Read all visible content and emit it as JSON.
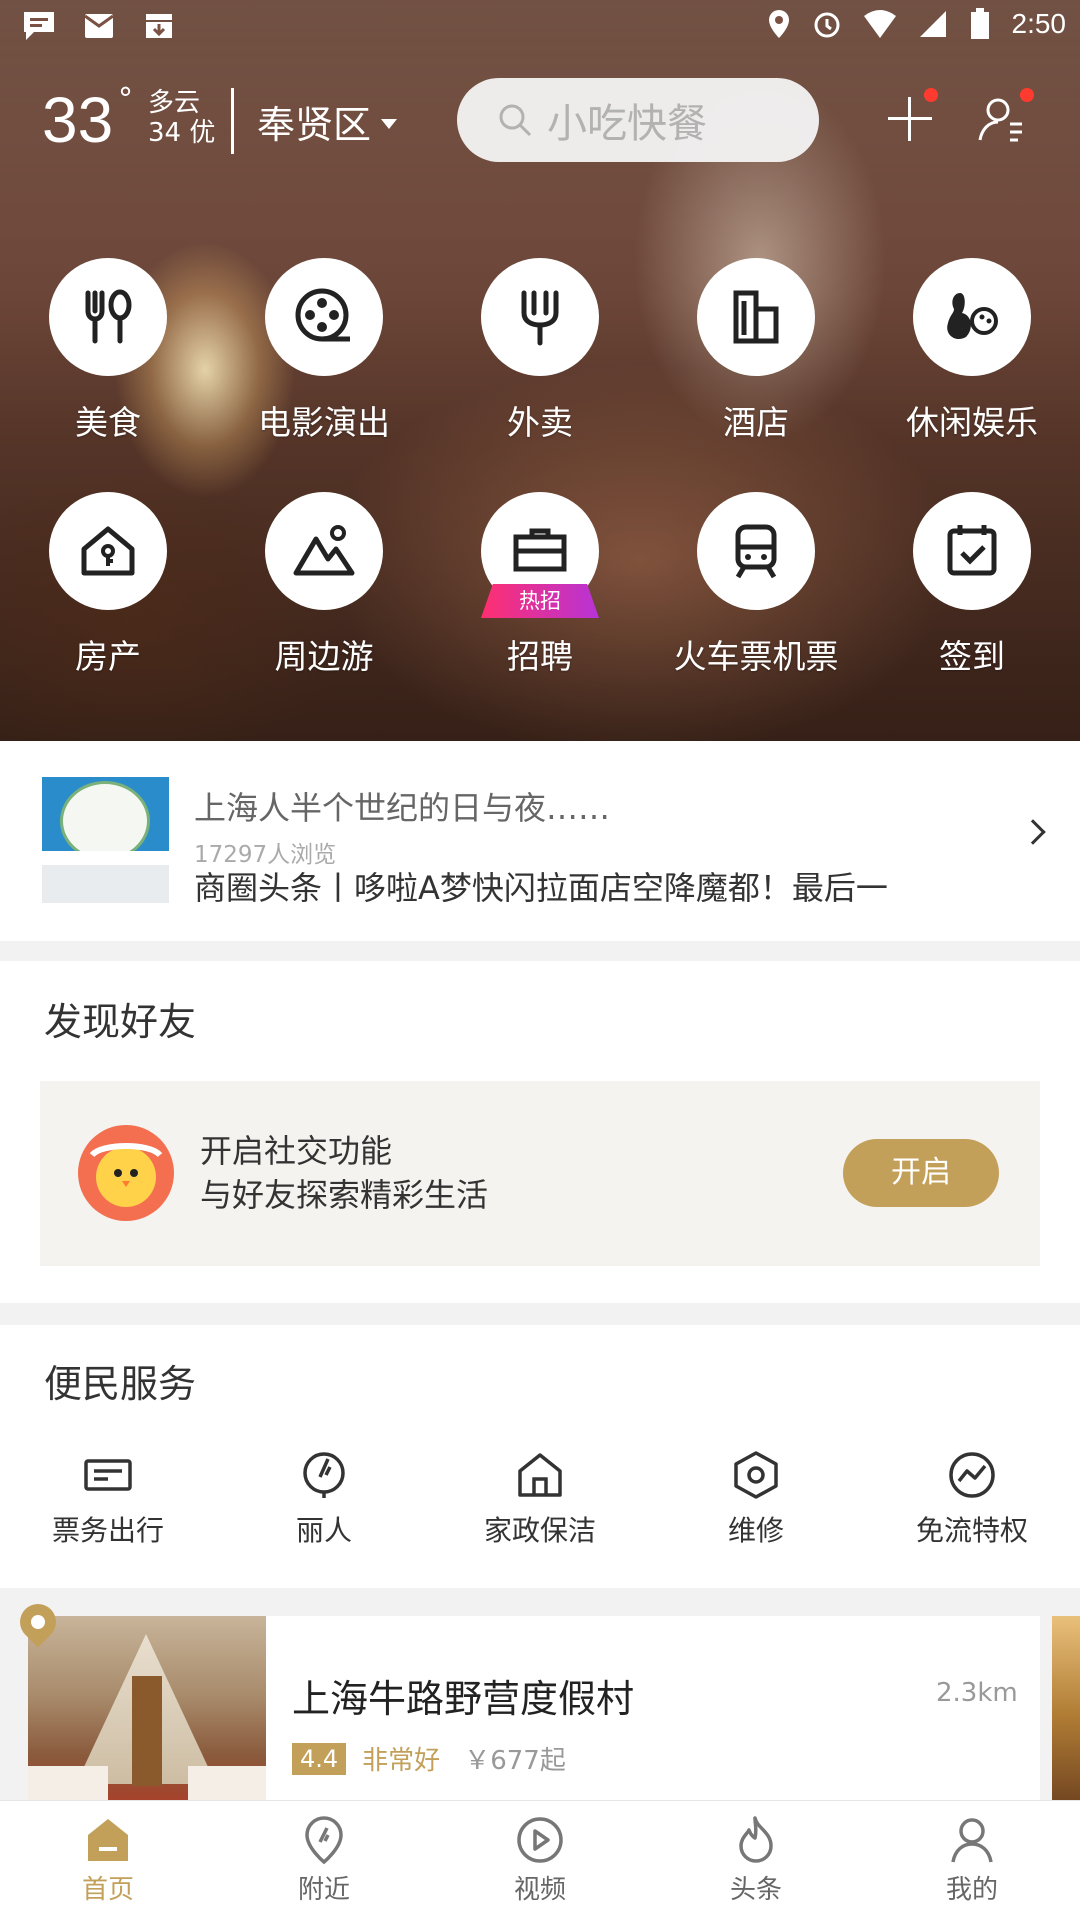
{
  "status_bar": {
    "time": "2:50"
  },
  "header": {
    "temperature": "33",
    "degree": "°",
    "weather": "多云",
    "aqi": "34 优",
    "district": "奉贤区",
    "search_placeholder": "小吃快餐"
  },
  "categories_row1": [
    {
      "label": "美食",
      "icon": "food-icon"
    },
    {
      "label": "电影演出",
      "icon": "film-reel-icon"
    },
    {
      "label": "外卖",
      "icon": "fork-icon"
    },
    {
      "label": "酒店",
      "icon": "hotel-icon"
    },
    {
      "label": "休闲娱乐",
      "icon": "leisure-icon"
    }
  ],
  "categories_row2": [
    {
      "label": "房产",
      "icon": "house-key-icon"
    },
    {
      "label": "周边游",
      "icon": "mountain-icon"
    },
    {
      "label": "招聘",
      "icon": "briefcase-icon",
      "badge": "热招"
    },
    {
      "label": "火车票机票",
      "icon": "train-icon"
    },
    {
      "label": "签到",
      "icon": "calendar-check-icon"
    }
  ],
  "news": {
    "headline": "上海人半个世纪的日与夜……",
    "views": "17297人浏览",
    "next_headline": "商圈头条丨哆啦A梦快闪拉面店空降魔都！最后一"
  },
  "friends": {
    "title": "发现好友",
    "line1": "开启社交功能",
    "line2": "与好友探索精彩生活",
    "button": "开启"
  },
  "services": {
    "title": "便民服务",
    "items": [
      {
        "label": "票务出行",
        "icon": "ticket-icon"
      },
      {
        "label": "丽人",
        "icon": "beauty-icon"
      },
      {
        "label": "家政保洁",
        "icon": "home-clean-icon"
      },
      {
        "label": "维修",
        "icon": "repair-icon"
      },
      {
        "label": "免流特权",
        "icon": "data-free-icon"
      }
    ]
  },
  "hotel": {
    "name": "上海牛路野营度假村",
    "distance": "2.3km",
    "score": "4.4",
    "rating": "非常好",
    "price": "￥677起"
  },
  "bottom_nav": [
    {
      "label": "首页",
      "icon": "home-icon",
      "active": true
    },
    {
      "label": "附近",
      "icon": "location-icon"
    },
    {
      "label": "视频",
      "icon": "video-icon"
    },
    {
      "label": "头条",
      "icon": "flame-icon"
    },
    {
      "label": "我的",
      "icon": "profile-icon"
    }
  ],
  "colors": {
    "accent": "#c3a05a",
    "badge_red": "#ff3b30"
  }
}
